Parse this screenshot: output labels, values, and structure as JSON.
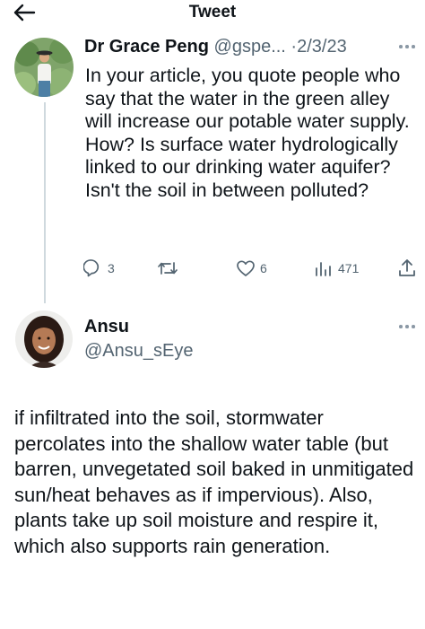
{
  "header": {
    "title": "Tweet",
    "back_icon": "arrow-left-icon"
  },
  "tweet": {
    "author_name": "Dr Grace Peng",
    "author_handle": "@gspe...",
    "separator": "·",
    "date": "2/3/23",
    "text": "In your article, you quote people who say that the water in the green alley will increase our potable water supply. How? Is surface water hydrologically linked to our drinking water aquifer? Isn't the soil in between polluted?",
    "actions": {
      "reply_icon": "reply-icon",
      "reply_count": "3",
      "retweet_icon": "retweet-icon",
      "retweet_count": "",
      "like_icon": "heart-icon",
      "like_count": "6",
      "views_icon": "views-icon",
      "views_count": "471",
      "share_icon": "share-icon"
    }
  },
  "reply": {
    "author_name": "Ansu",
    "author_handle": "@Ansu_sEye",
    "text": "if infiltrated into the soil, stormwater percolates into the shallow water table (but barren, unvegetated soil baked in unmitigated sun/heat behaves as if impervious).  Also, plants take up soil moisture and respire it, which also supports rain generation."
  },
  "colors": {
    "text": "#0f1419",
    "muted": "#536471",
    "icon": "#536471",
    "thread_line": "#cfd9de",
    "background": "#ffffff"
  }
}
